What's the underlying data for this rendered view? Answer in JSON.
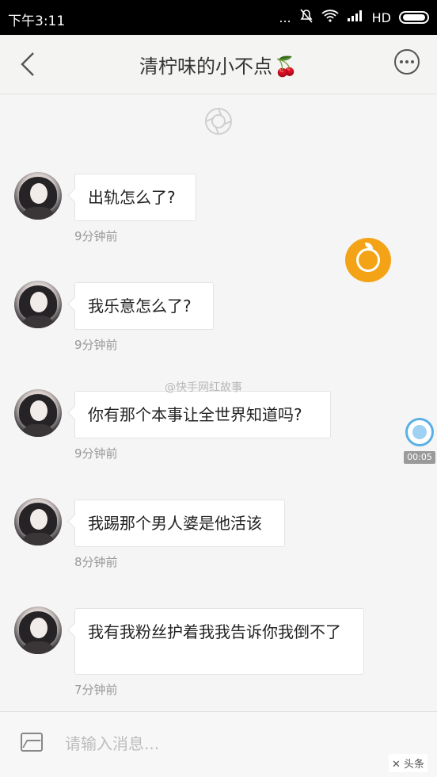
{
  "status_bar": {
    "time": "下午3:11",
    "dots": "...",
    "network": "HD"
  },
  "header": {
    "title": "清柠味的小不点",
    "title_emoji": "🍒"
  },
  "messages": [
    {
      "text": "出轨怎么了?",
      "time": "9分钟前"
    },
    {
      "text": "我乐意怎么了?",
      "time": "9分钟前"
    },
    {
      "text": "你有那个本事让全世界知道吗?",
      "time": "9分钟前"
    },
    {
      "text": "我踢那个男人婆是他活该",
      "time": "8分钟前"
    },
    {
      "text": "我有我粉丝护着我我告诉你我倒不了",
      "time": "7分钟前"
    }
  ],
  "overlay": {
    "watermark": "@快手网红故事",
    "recording_time": "00:05"
  },
  "input": {
    "placeholder": "请输入消息..."
  },
  "corner_logo": "✕ 头条"
}
